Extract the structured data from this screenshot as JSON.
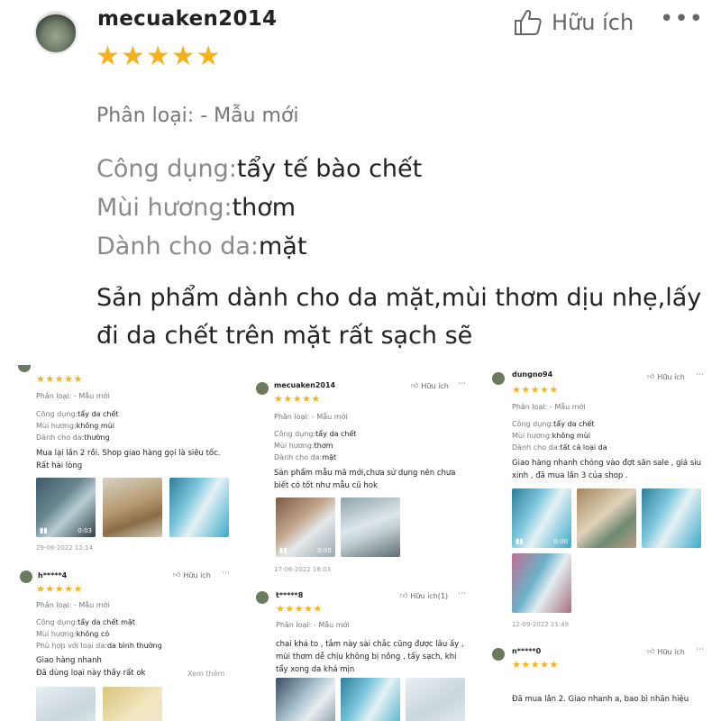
{
  "main_review": {
    "username": "mecuaken2014",
    "stars": "★★★★★",
    "helpful_label": "Hữu ích",
    "more": "•••",
    "variant": "Phân loại: - Mẫu mới",
    "attributes": [
      {
        "key": "Công dụng:",
        "value": "tẩy tế bào chết"
      },
      {
        "key": "Mùi hương:",
        "value": "thơm"
      },
      {
        "key": "Dành cho da:",
        "value": "mặt"
      }
    ],
    "text": "Sản phẩm dành cho da mặt,mùi thơm dịu nhẹ,lấy đi da chết trên mặt rất sạch sẽ"
  },
  "columns": [
    {
      "reviews": [
        {
          "stars": "★★★★★",
          "variant": "Phân loại: - Mẫu mới",
          "lines": [
            {
              "key": "Công dụng:",
              "value": "tẩy da chết"
            },
            {
              "key": "Mùi hương:",
              "value": "không mùi"
            },
            {
              "key": "Dành cho da:",
              "value": "thường"
            }
          ],
          "text": "Mua lại lần 2 rồi. Shop giao hàng gọi là siêu tốc. Rất hài lòng",
          "video_duration": "0:03",
          "date": "29-06-2022 12:14"
        },
        {
          "username": "h*****4",
          "helpful_label": "Hữu ích",
          "stars": "★★★★★",
          "variant": "Phân loại: - Mẫu mới",
          "lines": [
            {
              "key": "Công dụng:",
              "value": "tẩy da chết mặt"
            },
            {
              "key": "Mùi hương:",
              "value": "không có"
            },
            {
              "key": "Phù hợp với loại da:",
              "value": "da bình thường"
            }
          ],
          "text": "Giao hàng nhanh\nĐã dùng loại này thấy rất ok",
          "see_more": "Xem thêm"
        }
      ]
    },
    {
      "reviews": [
        {
          "username": "mecuaken2014",
          "helpful_label": "Hữu ích",
          "stars": "★★★★★",
          "variant": "Phân loại: - Mẫu mới",
          "lines": [
            {
              "key": "Công dụng:",
              "value": "tẩy da chết"
            },
            {
              "key": "Mùi hương:",
              "value": "thơm"
            },
            {
              "key": "Dành cho da:",
              "value": "mặt"
            }
          ],
          "text": "Sản phẩm mẫu mã mới,chưa sử dụng nên chưa biết có tốt như mẫu cũ hok",
          "video_duration": "0:05",
          "date": "17-06-2022 16:03"
        },
        {
          "username": "t*****8",
          "helpful_label": "Hữu ích(1)",
          "stars": "★★★★★",
          "variant": "Phân loại: - Mẫu mới",
          "text": "chai khá to , tắm này sài chắc cũng được lâu ấy , mùi thơm dễ chịu không bị nồng , tẩy sạch, khi tẩy xong da khá mịn"
        }
      ]
    },
    {
      "reviews": [
        {
          "username": "dungno94",
          "helpful_label": "Hữu ích",
          "stars": "★★★★★",
          "variant": "Phân loại: - Mẫu mới",
          "lines": [
            {
              "key": "Công dụng:",
              "value": "tẩy da chết"
            },
            {
              "key": "Mùi hương:",
              "value": "không mùi"
            },
            {
              "key": "Dành cho da:",
              "value": "tất cả loại da"
            }
          ],
          "text": "Giao hàng nhanh chóng vào đợt săn sale , giá siu xinh , đã mua lần 3 của shop .",
          "video_duration": "0:00",
          "date": "12-09-2022 21:49"
        },
        {
          "username": "n*****0",
          "helpful_label": "Hữu ích",
          "stars": "★★★★★",
          "text": "Đã mua lần 2. Giao nhanh a, bao bì nhãn hiệu"
        }
      ]
    }
  ]
}
